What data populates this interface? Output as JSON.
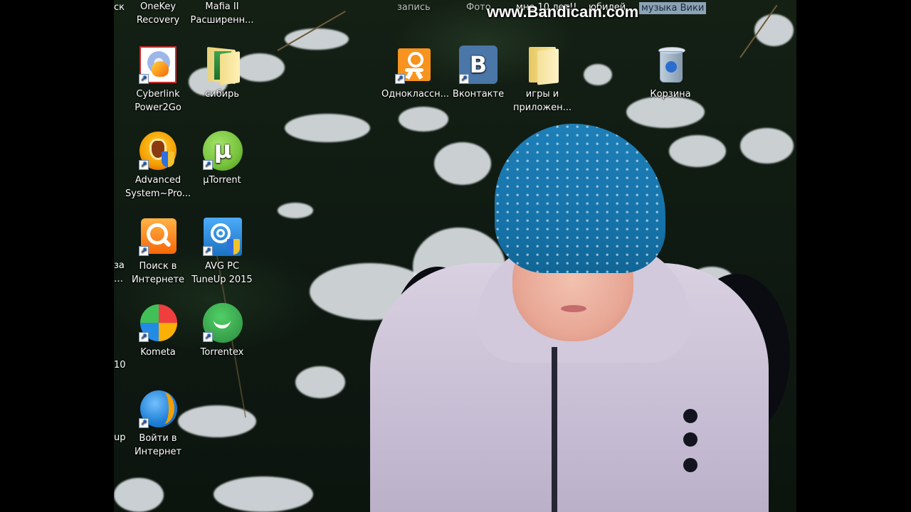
{
  "watermark": "www.Bandicam.com",
  "top_bar_labels": {
    "partial_1": "запись",
    "partial_2": "Фото",
    "partial_3": "мне 10 лет!!",
    "jubilee": "юбилей",
    "music_vika": "музыка Вики"
  },
  "cut_off_labels": {
    "top_left": "ск",
    "row_3": "за",
    "row_3b": "…",
    "row_4": "10",
    "row_5": "up"
  },
  "icons": {
    "onekey": "OneKey\nRecovery",
    "mafia": "Mafia II\nРасширенн...",
    "cyberlink": "Cyberlink\nPower2Go",
    "sibir": "сибирь",
    "odnoklassniki": "Одноклассн...",
    "vkontakte": "Вконтакте",
    "games": "игры и\nприложен...",
    "recycle": "Корзина",
    "advanced": "Advanced\nSystem~Pro...",
    "utorrent": "µTorrent",
    "search": "Поиск в\nИнтернете",
    "avg": "AVG PC\nTuneUp 2015",
    "kometa": "Kometa",
    "torrentex": "Torrentex",
    "login": "Войти в\nИнтернет"
  },
  "colors": {
    "ok_orange": "#f7931e",
    "vk_blue": "#4a76a8",
    "utorrent_green": "#76c23a",
    "hat_blue": "#1a78b2"
  }
}
